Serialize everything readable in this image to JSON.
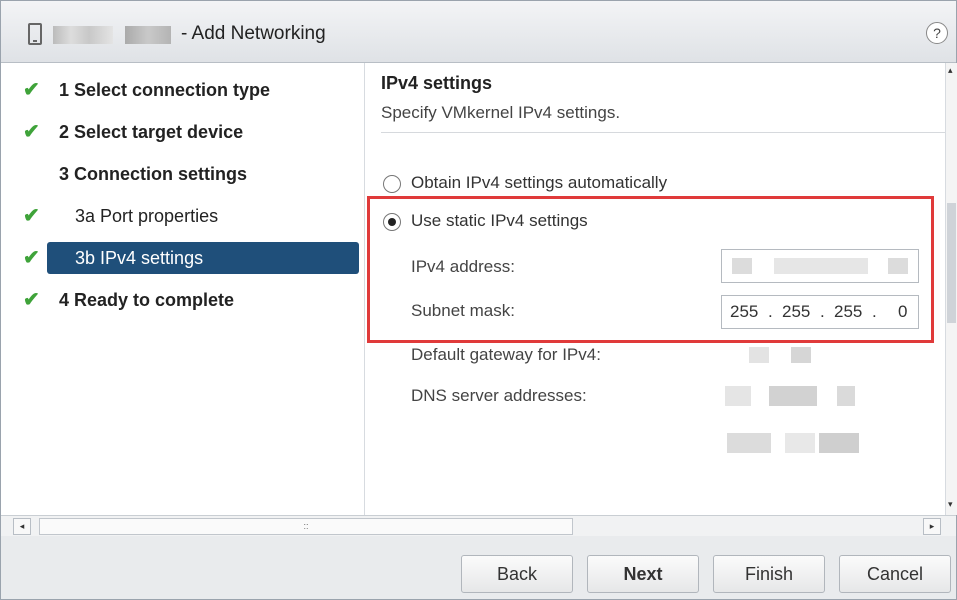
{
  "window": {
    "title": "- Add Networking",
    "help_label": "?"
  },
  "steps": [
    {
      "label": "1  Select connection type",
      "check": "✔"
    },
    {
      "label": "2  Select target device",
      "check": "✔"
    },
    {
      "label": "3  Connection settings",
      "check": ""
    },
    {
      "label": "3a  Port properties",
      "check": "✔"
    },
    {
      "label": "3b  IPv4 settings",
      "check": "✔"
    },
    {
      "label": "4  Ready to complete",
      "check": "✔"
    }
  ],
  "content": {
    "title": "IPv4 settings",
    "subtitle": "Specify VMkernel IPv4 settings.",
    "option_auto": "Obtain IPv4 settings automatically",
    "option_static": "Use static IPv4 settings",
    "ipv4_label": "IPv4 address:",
    "subnet_label": "Subnet mask:",
    "subnet_octets": [
      "255",
      "255",
      "255",
      "0"
    ],
    "subnet_dot": ".",
    "gateway_label": "Default gateway for IPv4:",
    "dns_label": "DNS server addresses:"
  },
  "scroll": {
    "left": "◂",
    "right": "▸",
    "grip": "::",
    "up": "▴",
    "down": "▾"
  },
  "buttons": {
    "back": "Back",
    "next": "Next",
    "finish": "Finish",
    "cancel": "Cancel"
  },
  "colors": {
    "accent": "#1f4f7a",
    "check": "#3fa33a",
    "highlight": "#e03a3a"
  }
}
